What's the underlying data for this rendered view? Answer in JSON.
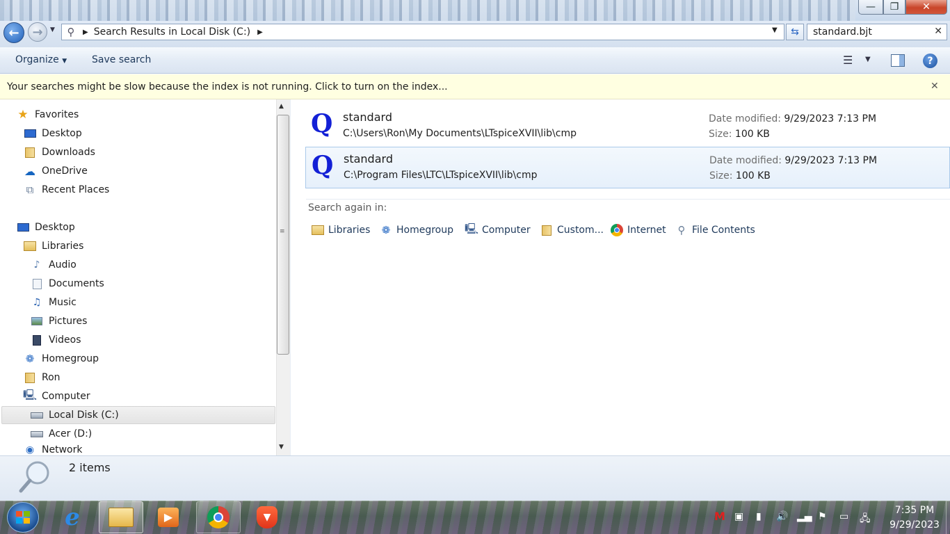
{
  "window": {
    "minimize_glyph": "—",
    "maximize_glyph": "❐",
    "close_glyph": "✕"
  },
  "address": {
    "path": "Search Results in Local Disk (C:)",
    "search_value": "standard.bjt",
    "search_clear": "✕"
  },
  "toolbar": {
    "organize": "Organize",
    "save_search": "Save search"
  },
  "infobar": {
    "message": "Your searches might be slow because the index is not running.  Click to turn on the index...",
    "close": "✕"
  },
  "nav": {
    "favorites": "Favorites",
    "desktop_fav": "Desktop",
    "downloads": "Downloads",
    "onedrive": "OneDrive",
    "recent_places": "Recent Places",
    "desktop": "Desktop",
    "libraries": "Libraries",
    "audio": "Audio",
    "documents": "Documents",
    "music": "Music",
    "pictures": "Pictures",
    "videos": "Videos",
    "homegroup": "Homegroup",
    "ron": "Ron",
    "computer": "Computer",
    "local_disk": "Local Disk (C:)",
    "acer": "Acer (D:)",
    "network": "Network"
  },
  "results": [
    {
      "name": "standard",
      "path": "C:\\Users\\Ron\\My Documents\\LTspiceXVII\\lib\\cmp",
      "date_label": "Date modified:",
      "date": "9/29/2023 7:13 PM",
      "size_label": "Size:",
      "size": "100 KB"
    },
    {
      "name": "standard",
      "path": "C:\\Program Files\\LTC\\LTspiceXVII\\lib\\cmp",
      "date_label": "Date modified:",
      "date": "9/29/2023 7:13 PM",
      "size_label": "Size:",
      "size": "100 KB"
    }
  ],
  "search_again": {
    "label": "Search again in:",
    "libraries": "Libraries",
    "homegroup": "Homegroup",
    "computer": "Computer",
    "custom": "Custom...",
    "internet": "Internet",
    "file_contents": "File Contents"
  },
  "details": {
    "count": "2 items"
  },
  "taskbar": {
    "time": "7:35 PM",
    "date": "9/29/2023"
  },
  "colors": {
    "accent": "#1e395b",
    "infobar_bg": "#ffffe1",
    "selected_result": "#e6f0fb",
    "file_icon": "#1320d6"
  }
}
